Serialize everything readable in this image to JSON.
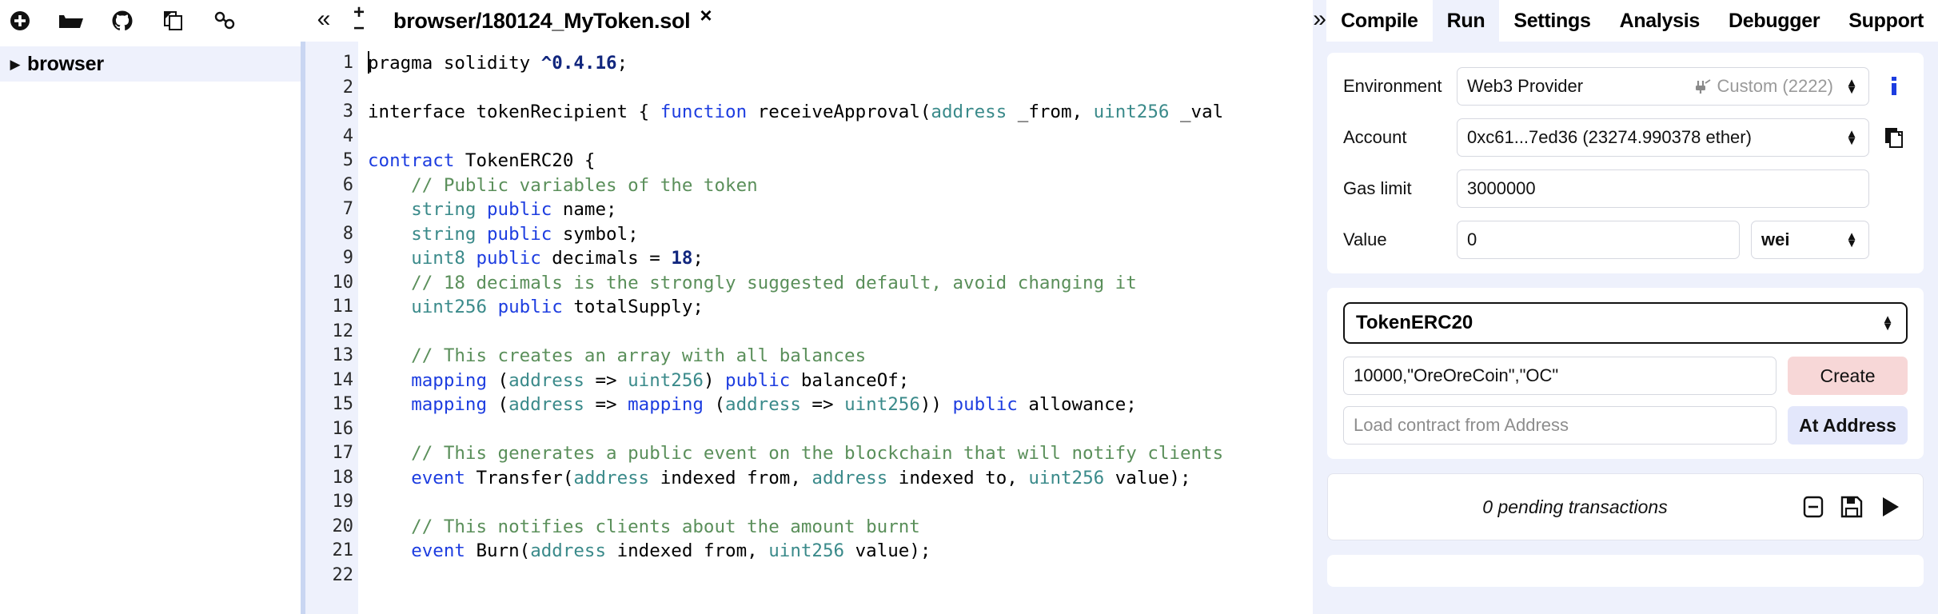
{
  "sidebar": {
    "toolbar_icons": [
      {
        "name": "add-file-icon",
        "label": "Add file"
      },
      {
        "name": "open-folder-icon",
        "label": "Open folder"
      },
      {
        "name": "github-icon",
        "label": "GitHub"
      },
      {
        "name": "copy-files-icon",
        "label": "Copy"
      },
      {
        "name": "link-icon",
        "label": "Link"
      }
    ],
    "tree": {
      "caret": "▶",
      "label": "browser"
    }
  },
  "editor": {
    "collapse_icon": "«",
    "zoom_in": "+",
    "zoom_out": "−",
    "tab": {
      "filename": "browser/180124_MyToken.sol",
      "close": "×"
    },
    "lines": [
      {
        "n": 1,
        "fold": false,
        "tokens": [
          {
            "t": "pragma solidity ",
            "c": ""
          },
          {
            "t": "^0.4.16",
            "c": "num"
          },
          {
            "t": ";",
            "c": ""
          }
        ]
      },
      {
        "n": 2,
        "fold": false,
        "tokens": []
      },
      {
        "n": 3,
        "fold": false,
        "tokens": [
          {
            "t": "interface tokenRecipient { ",
            "c": ""
          },
          {
            "t": "function",
            "c": "kw"
          },
          {
            "t": " receiveApproval(",
            "c": ""
          },
          {
            "t": "address",
            "c": "typ"
          },
          {
            "t": " _from, ",
            "c": ""
          },
          {
            "t": "uint256",
            "c": "typ"
          },
          {
            "t": " _val",
            "c": ""
          }
        ]
      },
      {
        "n": 4,
        "fold": false,
        "tokens": []
      },
      {
        "n": 5,
        "fold": true,
        "tokens": [
          {
            "t": "contract",
            "c": "kw"
          },
          {
            "t": " TokenERC20 {",
            "c": ""
          }
        ]
      },
      {
        "n": 6,
        "fold": false,
        "tokens": [
          {
            "t": "    // Public variables of the token",
            "c": "com"
          }
        ]
      },
      {
        "n": 7,
        "fold": false,
        "tokens": [
          {
            "t": "    ",
            "c": ""
          },
          {
            "t": "string",
            "c": "typ"
          },
          {
            "t": " ",
            "c": ""
          },
          {
            "t": "public",
            "c": "kw"
          },
          {
            "t": " name;",
            "c": ""
          }
        ]
      },
      {
        "n": 8,
        "fold": false,
        "tokens": [
          {
            "t": "    ",
            "c": ""
          },
          {
            "t": "string",
            "c": "typ"
          },
          {
            "t": " ",
            "c": ""
          },
          {
            "t": "public",
            "c": "kw"
          },
          {
            "t": " symbol;",
            "c": ""
          }
        ]
      },
      {
        "n": 9,
        "fold": false,
        "tokens": [
          {
            "t": "    ",
            "c": ""
          },
          {
            "t": "uint8",
            "c": "typ"
          },
          {
            "t": " ",
            "c": ""
          },
          {
            "t": "public",
            "c": "kw"
          },
          {
            "t": " decimals = ",
            "c": ""
          },
          {
            "t": "18",
            "c": "num"
          },
          {
            "t": ";",
            "c": ""
          }
        ]
      },
      {
        "n": 10,
        "fold": false,
        "tokens": [
          {
            "t": "    // 18 decimals is the strongly suggested default, avoid changing it",
            "c": "com"
          }
        ]
      },
      {
        "n": 11,
        "fold": false,
        "tokens": [
          {
            "t": "    ",
            "c": ""
          },
          {
            "t": "uint256",
            "c": "typ"
          },
          {
            "t": " ",
            "c": ""
          },
          {
            "t": "public",
            "c": "kw"
          },
          {
            "t": " totalSupply;",
            "c": ""
          }
        ]
      },
      {
        "n": 12,
        "fold": false,
        "tokens": []
      },
      {
        "n": 13,
        "fold": false,
        "tokens": [
          {
            "t": "    // This creates an array with all balances",
            "c": "com"
          }
        ]
      },
      {
        "n": 14,
        "fold": false,
        "tokens": [
          {
            "t": "    ",
            "c": ""
          },
          {
            "t": "mapping",
            "c": "kw"
          },
          {
            "t": " (",
            "c": ""
          },
          {
            "t": "address",
            "c": "typ"
          },
          {
            "t": " => ",
            "c": ""
          },
          {
            "t": "uint256",
            "c": "typ"
          },
          {
            "t": ") ",
            "c": ""
          },
          {
            "t": "public",
            "c": "kw"
          },
          {
            "t": " balanceOf;",
            "c": ""
          }
        ]
      },
      {
        "n": 15,
        "fold": false,
        "tokens": [
          {
            "t": "    ",
            "c": ""
          },
          {
            "t": "mapping",
            "c": "kw"
          },
          {
            "t": " (",
            "c": ""
          },
          {
            "t": "address",
            "c": "typ"
          },
          {
            "t": " => ",
            "c": ""
          },
          {
            "t": "mapping",
            "c": "kw"
          },
          {
            "t": " (",
            "c": ""
          },
          {
            "t": "address",
            "c": "typ"
          },
          {
            "t": " => ",
            "c": ""
          },
          {
            "t": "uint256",
            "c": "typ"
          },
          {
            "t": ")) ",
            "c": ""
          },
          {
            "t": "public",
            "c": "kw"
          },
          {
            "t": " allowance;",
            "c": ""
          }
        ]
      },
      {
        "n": 16,
        "fold": false,
        "tokens": []
      },
      {
        "n": 17,
        "fold": false,
        "tokens": [
          {
            "t": "    // This generates a public event on the blockchain that will notify clients",
            "c": "com"
          }
        ]
      },
      {
        "n": 18,
        "fold": false,
        "tokens": [
          {
            "t": "    ",
            "c": ""
          },
          {
            "t": "event",
            "c": "kw"
          },
          {
            "t": " Transfer(",
            "c": ""
          },
          {
            "t": "address",
            "c": "typ"
          },
          {
            "t": " indexed from, ",
            "c": ""
          },
          {
            "t": "address",
            "c": "typ"
          },
          {
            "t": " indexed to, ",
            "c": ""
          },
          {
            "t": "uint256",
            "c": "typ"
          },
          {
            "t": " value);",
            "c": ""
          }
        ]
      },
      {
        "n": 19,
        "fold": false,
        "tokens": []
      },
      {
        "n": 20,
        "fold": false,
        "tokens": [
          {
            "t": "    // This notifies clients about the amount burnt",
            "c": "com"
          }
        ]
      },
      {
        "n": 21,
        "fold": false,
        "tokens": [
          {
            "t": "    ",
            "c": ""
          },
          {
            "t": "event",
            "c": "kw"
          },
          {
            "t": " Burn(",
            "c": ""
          },
          {
            "t": "address",
            "c": "typ"
          },
          {
            "t": " indexed from, ",
            "c": ""
          },
          {
            "t": "uint256",
            "c": "typ"
          },
          {
            "t": " value);",
            "c": ""
          }
        ]
      },
      {
        "n": 22,
        "fold": false,
        "tokens": []
      }
    ]
  },
  "right_panel": {
    "chevron": "»",
    "tabs": [
      {
        "label": "Compile",
        "active": false
      },
      {
        "label": "Run",
        "active": true
      },
      {
        "label": "Settings",
        "active": false
      },
      {
        "label": "Analysis",
        "active": false
      },
      {
        "label": "Debugger",
        "active": false
      },
      {
        "label": "Support",
        "active": false
      }
    ],
    "run": {
      "environment": {
        "label": "Environment",
        "value": "Web3 Provider",
        "detail": "Custom (2222)",
        "info_icon": "i"
      },
      "account": {
        "label": "Account",
        "value": "0xc61...7ed36 (23274.990378 ether)"
      },
      "gas_limit": {
        "label": "Gas limit",
        "value": "3000000"
      },
      "value": {
        "label": "Value",
        "amount": "0",
        "unit": "wei"
      },
      "contract": {
        "selected": "TokenERC20",
        "ctor_args": "10000,\"OreOreCoin\",\"OC\"",
        "create_label": "Create",
        "address_placeholder": "Load contract from Address",
        "at_address_label": "At Address"
      },
      "pending": {
        "text": "0 pending transactions"
      }
    }
  },
  "colors": {
    "panel_bg": "#eef1fc",
    "accent_blue": "#1d3de0",
    "create_btn": "#f7d7d7",
    "at_address_btn": "#e3e7fb",
    "comment_green": "#5a8f5a",
    "type_teal": "#3a8a8a"
  }
}
